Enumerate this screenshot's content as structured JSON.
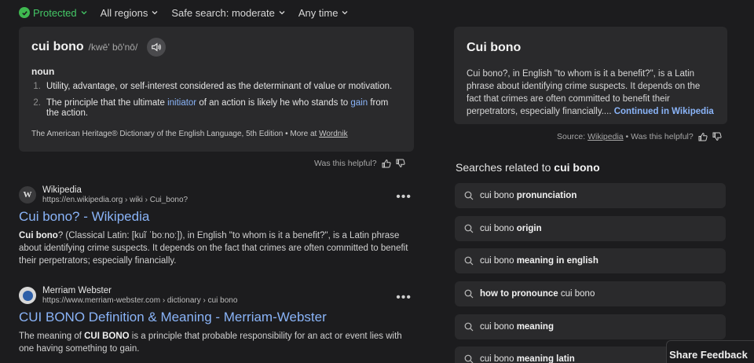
{
  "filters": {
    "protected": "Protected",
    "regions": "All regions",
    "safe_search": "Safe search: moderate",
    "time": "Any time"
  },
  "dictionary": {
    "word": "cui bono",
    "pronunciation": "/kwē' bō'nō/",
    "part_of_speech": "noun",
    "definitions": [
      {
        "num": "1.",
        "text": "Utility, advantage, or self-interest considered as the determinant of value or motivation."
      },
      {
        "num": "2.",
        "pre": "The principle that the ultimate ",
        "hl1": "initiator",
        "mid": " of an action is likely he who stands to ",
        "hl2": "gain",
        "post": " from the action."
      }
    ],
    "source": "The American Heritage® Dictionary of the English Language, 5th Edition •  More at ",
    "source_link": "Wordnik",
    "helpful": "Was this helpful?"
  },
  "results": [
    {
      "site": "Wikipedia",
      "favicon": "W",
      "url": "https://en.wikipedia.org › wiki › Cui_bono?",
      "title": "Cui bono? - Wikipedia",
      "snippet_bold": "Cui bono",
      "snippet": "? (Classical Latin: [kuĩ ˈboːnoː]), in English \"to whom is it a benefit?\", is a Latin phrase about identifying crime suspects. It depends on the fact that crimes are often committed to benefit their perpetrators; especially financially."
    },
    {
      "site": "Merriam Webster",
      "url": "https://www.merriam-webster.com › dictionary › cui bono",
      "title": "CUI BONO Definition & Meaning - Merriam-Webster",
      "snippet_pre": "The meaning of ",
      "snippet_bold": "CUI BONO",
      "snippet": " is a principle that probable responsibility for an act or event lies with one having something to gain."
    }
  ],
  "wiki_panel": {
    "title": "Cui bono",
    "text": "Cui bono?, in English \"to whom is it a benefit?\", is a Latin phrase about identifying crime suspects. It depends on the fact that crimes are often committed to benefit their perpetrators, especially financially.... ",
    "link": "Continued in Wikipedia",
    "source_label": "Source: ",
    "source_link": "Wikipedia",
    "helpful": " • Was this helpful?"
  },
  "related": {
    "title_pre": "Searches related to ",
    "title_bold": "cui bono",
    "items": [
      {
        "q": "cui bono ",
        "s": "pronunciation"
      },
      {
        "q": "cui bono ",
        "s": "origin"
      },
      {
        "q": "cui bono ",
        "s": "meaning in english"
      },
      {
        "q": "cui bono",
        "s": "how to pronounce ",
        "order": "suffix-first"
      },
      {
        "q": "cui bono ",
        "s": "meaning"
      },
      {
        "q": "cui bono ",
        "s": "meaning latin"
      }
    ]
  },
  "share_feedback": "Share Feedback",
  "colors": {
    "link": "#8ab4f8",
    "protected": "#3fb950",
    "background": "#1c1c1e",
    "card": "#2a2a2c"
  }
}
